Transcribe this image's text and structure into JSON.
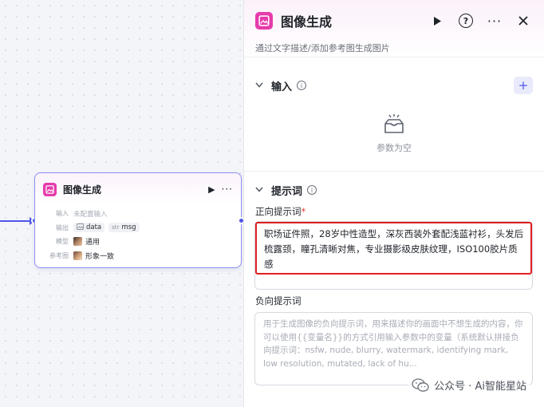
{
  "canvas": {
    "node": {
      "title": "图像生成",
      "rows": {
        "input_label": "输入",
        "input_value": "未配置输入",
        "output_label": "输出",
        "output_tag1": "data",
        "output_tag1_type": "img",
        "output_tag2": "msg",
        "output_tag2_type": "str",
        "model_label": "模型",
        "model_value": "通用",
        "ref_label": "参考图",
        "ref_value": "形象一致"
      }
    }
  },
  "panel": {
    "title": "图像生成",
    "description": "通过文字描述/添加参考图生成图片",
    "input_section": {
      "title": "输入",
      "empty_text": "参数为空"
    },
    "prompt_section": {
      "title": "提示词",
      "positive_label": "正向提示词",
      "required_mark": "*",
      "positive_value": "职场证件照，28岁中性造型，深灰西装外套配浅蓝衬衫，头发后梳露颈，瞳孔清晰对焦，专业摄影级皮肤纹理，ISO100胶片质感",
      "negative_label": "负向提示词",
      "negative_placeholder": "用于生成图像的负向提示词，用来描述你的画面中不想生成的内容，你可以使用{{变量名}}的方式引用输入参数中的变量（系统默认拼接负向提示词：nsfw, nude, blurry, watermark, identifying mark, low resolution, mutated, lack of hu..."
    }
  },
  "watermark": {
    "text": "公众号 · Ai智能星站"
  },
  "colors": {
    "accent": "#4e55e8",
    "node_icon": "#e63bab",
    "highlight": "#e02020"
  }
}
